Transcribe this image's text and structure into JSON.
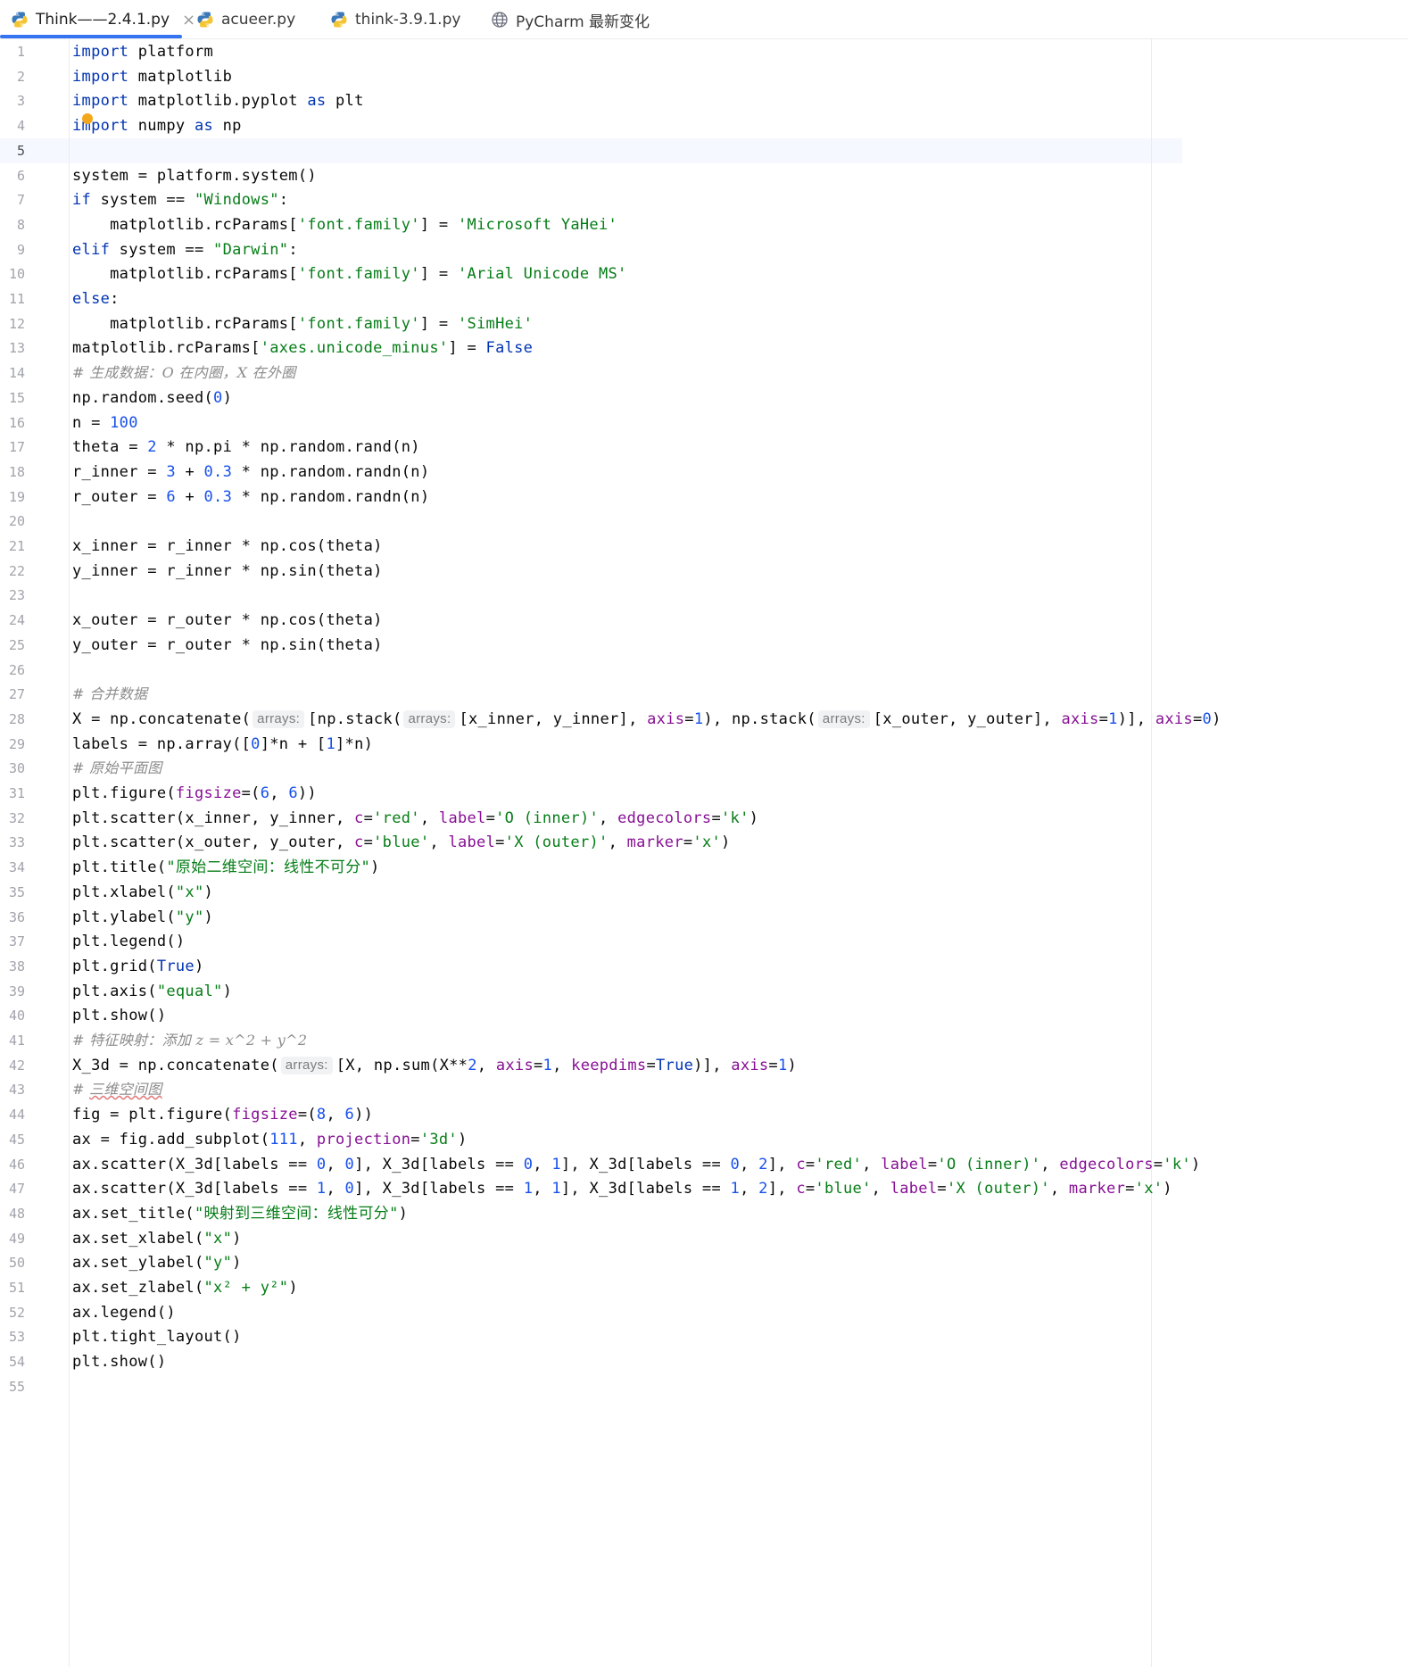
{
  "tabs": [
    {
      "label": "Think——2.4.1.py",
      "icon": "python-file-icon",
      "active": true,
      "closable": true
    },
    {
      "label": "acueer.py",
      "icon": "python-file-icon",
      "active": false
    },
    {
      "label": "think-3.9.1.py",
      "icon": "python-file-icon",
      "active": false
    },
    {
      "label": "PyCharm 最新变化",
      "icon": "globe-icon",
      "active": false
    }
  ],
  "editor": {
    "active_line": 5,
    "line_numbers": [
      "1",
      "2",
      "3",
      "4",
      "5",
      "6",
      "7",
      "8",
      "9",
      "10",
      "11",
      "12",
      "13",
      "14",
      "15",
      "16",
      "17",
      "18",
      "19",
      "20",
      "21",
      "22",
      "23",
      "24",
      "25",
      "26",
      "27",
      "28",
      "29",
      "30",
      "31",
      "32",
      "33",
      "34",
      "35",
      "36",
      "37",
      "38",
      "39",
      "40",
      "41",
      "42",
      "43",
      "44",
      "45",
      "46",
      "47",
      "48",
      "49",
      "50",
      "51",
      "52",
      "53",
      "54",
      "55"
    ],
    "lines": [
      [
        [
          "k",
          "import"
        ],
        [
          "t",
          " platform"
        ]
      ],
      [
        [
          "k",
          "import"
        ],
        [
          "t",
          " matplotlib"
        ]
      ],
      [
        [
          "k",
          "import"
        ],
        [
          "t",
          " matplotlib.pyplot "
        ],
        [
          "k",
          "as"
        ],
        [
          "t",
          " plt"
        ]
      ],
      [
        [
          "k",
          "import"
        ],
        [
          "t",
          " numpy "
        ],
        [
          "k",
          "as"
        ],
        [
          "t",
          " np"
        ]
      ],
      [],
      [
        [
          "t",
          "system = platform.system()"
        ]
      ],
      [
        [
          "k",
          "if"
        ],
        [
          "t",
          " system == "
        ],
        [
          "s",
          "\"Windows\""
        ],
        [
          "t",
          ":"
        ]
      ],
      [
        [
          "t",
          "    matplotlib.rcParams["
        ],
        [
          "s",
          "'font.family'"
        ],
        [
          "t",
          "] = "
        ],
        [
          "s",
          "'Microsoft YaHei'"
        ]
      ],
      [
        [
          "k",
          "elif"
        ],
        [
          "t",
          " system == "
        ],
        [
          "s",
          "\"Darwin\""
        ],
        [
          "t",
          ":"
        ]
      ],
      [
        [
          "t",
          "    matplotlib.rcParams["
        ],
        [
          "s",
          "'font.family'"
        ],
        [
          "t",
          "] = "
        ],
        [
          "s",
          "'Arial Unicode MS'"
        ]
      ],
      [
        [
          "k",
          "else"
        ],
        [
          "t",
          ":"
        ]
      ],
      [
        [
          "t",
          "    matplotlib.rcParams["
        ],
        [
          "s",
          "'font.family'"
        ],
        [
          "t",
          "] = "
        ],
        [
          "s",
          "'SimHei'"
        ]
      ],
      [
        [
          "t",
          "matplotlib.rcParams["
        ],
        [
          "s",
          "'axes.unicode_minus'"
        ],
        [
          "t",
          "] = "
        ],
        [
          "k",
          "False"
        ]
      ],
      [
        [
          "c",
          "# 生成数据：O 在内圈，X 在外圈"
        ]
      ],
      [
        [
          "t",
          "np.random.seed("
        ],
        [
          "n",
          "0"
        ],
        [
          "t",
          ")"
        ]
      ],
      [
        [
          "t",
          "n = "
        ],
        [
          "n",
          "100"
        ]
      ],
      [
        [
          "t",
          "theta = "
        ],
        [
          "n",
          "2"
        ],
        [
          "t",
          " * np.pi * np.random.rand(n)"
        ]
      ],
      [
        [
          "t",
          "r_inner = "
        ],
        [
          "n",
          "3"
        ],
        [
          "t",
          " + "
        ],
        [
          "n",
          "0.3"
        ],
        [
          "t",
          " * np.random.randn(n)"
        ]
      ],
      [
        [
          "t",
          "r_outer = "
        ],
        [
          "n",
          "6"
        ],
        [
          "t",
          " + "
        ],
        [
          "n",
          "0.3"
        ],
        [
          "t",
          " * np.random.randn(n)"
        ]
      ],
      [],
      [
        [
          "t",
          "x_inner = r_inner * np.cos(theta)"
        ]
      ],
      [
        [
          "t",
          "y_inner = r_inner * np.sin(theta)"
        ]
      ],
      [],
      [
        [
          "t",
          "x_outer = r_outer * np.cos(theta)"
        ]
      ],
      [
        [
          "t",
          "y_outer = r_outer * np.sin(theta)"
        ]
      ],
      [],
      [
        [
          "c",
          "# 合并数据"
        ]
      ],
      [
        [
          "t",
          "X = np.concatenate("
        ],
        [
          "h",
          "arrays:"
        ],
        [
          "t",
          "[np.stack("
        ],
        [
          "h",
          "arrays:"
        ],
        [
          "t",
          "[x_inner, y_inner], "
        ],
        [
          "kw",
          "axis"
        ],
        [
          "t",
          "="
        ],
        [
          "n",
          "1"
        ],
        [
          "t",
          "), np.stack("
        ],
        [
          "h",
          "arrays:"
        ],
        [
          "t",
          "[x_outer, y_outer], "
        ],
        [
          "kw",
          "axis"
        ],
        [
          "t",
          "="
        ],
        [
          "n",
          "1"
        ],
        [
          "t",
          ")], "
        ],
        [
          "kw",
          "axis"
        ],
        [
          "t",
          "="
        ],
        [
          "n",
          "0"
        ],
        [
          "t",
          ")"
        ]
      ],
      [
        [
          "t",
          "labels = np.array(["
        ],
        [
          "n",
          "0"
        ],
        [
          "t",
          "]*n + ["
        ],
        [
          "n",
          "1"
        ],
        [
          "t",
          "]*n)"
        ]
      ],
      [
        [
          "c",
          "# 原始平面图"
        ]
      ],
      [
        [
          "t",
          "plt.figure("
        ],
        [
          "kw",
          "figsize"
        ],
        [
          "t",
          "=("
        ],
        [
          "n",
          "6"
        ],
        [
          "t",
          ", "
        ],
        [
          "n",
          "6"
        ],
        [
          "t",
          "))"
        ]
      ],
      [
        [
          "t",
          "plt.scatter(x_inner, y_inner, "
        ],
        [
          "kw",
          "c"
        ],
        [
          "t",
          "="
        ],
        [
          "s",
          "'red'"
        ],
        [
          "t",
          ", "
        ],
        [
          "kw",
          "label"
        ],
        [
          "t",
          "="
        ],
        [
          "s",
          "'O (inner)'"
        ],
        [
          "t",
          ", "
        ],
        [
          "kw",
          "edgecolors"
        ],
        [
          "t",
          "="
        ],
        [
          "s",
          "'k'"
        ],
        [
          "t",
          ")"
        ]
      ],
      [
        [
          "t",
          "plt.scatter(x_outer, y_outer, "
        ],
        [
          "kw",
          "c"
        ],
        [
          "t",
          "="
        ],
        [
          "s",
          "'blue'"
        ],
        [
          "t",
          ", "
        ],
        [
          "kw",
          "label"
        ],
        [
          "t",
          "="
        ],
        [
          "s",
          "'X (outer)'"
        ],
        [
          "t",
          ", "
        ],
        [
          "kw",
          "marker"
        ],
        [
          "t",
          "="
        ],
        [
          "s",
          "'x'"
        ],
        [
          "t",
          ")"
        ]
      ],
      [
        [
          "t",
          "plt.title("
        ],
        [
          "s",
          "\"原始二维空间：线性不可分\""
        ],
        [
          "t",
          ")"
        ]
      ],
      [
        [
          "t",
          "plt.xlabel("
        ],
        [
          "s",
          "\"x\""
        ],
        [
          "t",
          ")"
        ]
      ],
      [
        [
          "t",
          "plt.ylabel("
        ],
        [
          "s",
          "\"y\""
        ],
        [
          "t",
          ")"
        ]
      ],
      [
        [
          "t",
          "plt.legend()"
        ]
      ],
      [
        [
          "t",
          "plt.grid("
        ],
        [
          "k",
          "True"
        ],
        [
          "t",
          ")"
        ]
      ],
      [
        [
          "t",
          "plt.axis("
        ],
        [
          "s",
          "\"equal\""
        ],
        [
          "t",
          ")"
        ]
      ],
      [
        [
          "t",
          "plt.show()"
        ]
      ],
      [
        [
          "c",
          "# 特征映射：添加 z = x^2 + y^2"
        ]
      ],
      [
        [
          "t",
          "X_3d = np.concatenate("
        ],
        [
          "h",
          "arrays:"
        ],
        [
          "t",
          "[X, np.sum(X**"
        ],
        [
          "n",
          "2"
        ],
        [
          "t",
          ", "
        ],
        [
          "kw",
          "axis"
        ],
        [
          "t",
          "="
        ],
        [
          "n",
          "1"
        ],
        [
          "t",
          ", "
        ],
        [
          "kw",
          "keepdims"
        ],
        [
          "t",
          "="
        ],
        [
          "k",
          "True"
        ],
        [
          "t",
          ")], "
        ],
        [
          "kw",
          "axis"
        ],
        [
          "t",
          "="
        ],
        [
          "n",
          "1"
        ],
        [
          "t",
          ")"
        ]
      ],
      [
        [
          "c",
          "# "
        ],
        [
          "cs",
          "三维空间图"
        ]
      ],
      [
        [
          "t",
          "fig = plt.figure("
        ],
        [
          "kw",
          "figsize"
        ],
        [
          "t",
          "=("
        ],
        [
          "n",
          "8"
        ],
        [
          "t",
          ", "
        ],
        [
          "n",
          "6"
        ],
        [
          "t",
          "))"
        ]
      ],
      [
        [
          "t",
          "ax = fig.add_subplot("
        ],
        [
          "n",
          "111"
        ],
        [
          "t",
          ", "
        ],
        [
          "kw",
          "projection"
        ],
        [
          "t",
          "="
        ],
        [
          "s",
          "'3d'"
        ],
        [
          "t",
          ")"
        ]
      ],
      [
        [
          "t",
          "ax.scatter(X_3d[labels == "
        ],
        [
          "n",
          "0"
        ],
        [
          "t",
          ", "
        ],
        [
          "n",
          "0"
        ],
        [
          "t",
          "], X_3d[labels == "
        ],
        [
          "n",
          "0"
        ],
        [
          "t",
          ", "
        ],
        [
          "n",
          "1"
        ],
        [
          "t",
          "], X_3d[labels == "
        ],
        [
          "n",
          "0"
        ],
        [
          "t",
          ", "
        ],
        [
          "n",
          "2"
        ],
        [
          "t",
          "], "
        ],
        [
          "kw",
          "c"
        ],
        [
          "t",
          "="
        ],
        [
          "s",
          "'red'"
        ],
        [
          "t",
          ", "
        ],
        [
          "kw",
          "label"
        ],
        [
          "t",
          "="
        ],
        [
          "s",
          "'O (inner)'"
        ],
        [
          "t",
          ", "
        ],
        [
          "kw",
          "edgecolors"
        ],
        [
          "t",
          "="
        ],
        [
          "s",
          "'k'"
        ],
        [
          "t",
          ")"
        ]
      ],
      [
        [
          "t",
          "ax.scatter(X_3d[labels == "
        ],
        [
          "n",
          "1"
        ],
        [
          "t",
          ", "
        ],
        [
          "n",
          "0"
        ],
        [
          "t",
          "], X_3d[labels == "
        ],
        [
          "n",
          "1"
        ],
        [
          "t",
          ", "
        ],
        [
          "n",
          "1"
        ],
        [
          "t",
          "], X_3d[labels == "
        ],
        [
          "n",
          "1"
        ],
        [
          "t",
          ", "
        ],
        [
          "n",
          "2"
        ],
        [
          "t",
          "], "
        ],
        [
          "kw",
          "c"
        ],
        [
          "t",
          "="
        ],
        [
          "s",
          "'blue'"
        ],
        [
          "t",
          ", "
        ],
        [
          "kw",
          "label"
        ],
        [
          "t",
          "="
        ],
        [
          "s",
          "'X (outer)'"
        ],
        [
          "t",
          ", "
        ],
        [
          "kw",
          "marker"
        ],
        [
          "t",
          "="
        ],
        [
          "s",
          "'x'"
        ],
        [
          "t",
          ")"
        ]
      ],
      [
        [
          "t",
          "ax.set_title("
        ],
        [
          "s",
          "\"映射到三维空间：线性可分\""
        ],
        [
          "t",
          ")"
        ]
      ],
      [
        [
          "t",
          "ax.set_xlabel("
        ],
        [
          "s",
          "\"x\""
        ],
        [
          "t",
          ")"
        ]
      ],
      [
        [
          "t",
          "ax.set_ylabel("
        ],
        [
          "s",
          "\"y\""
        ],
        [
          "t",
          ")"
        ]
      ],
      [
        [
          "t",
          "ax.set_zlabel("
        ],
        [
          "s",
          "\"x² + y²\""
        ],
        [
          "t",
          ")"
        ]
      ],
      [
        [
          "t",
          "ax.legend()"
        ]
      ],
      [
        [
          "t",
          "plt.tight_layout()"
        ]
      ],
      [
        [
          "t",
          "plt.show()"
        ]
      ],
      []
    ]
  },
  "colors": {
    "keyword": "#0033b3",
    "string": "#067d17",
    "number": "#1750eb",
    "comment": "#8c8c8c",
    "named_arg": "#871094",
    "tab_accent": "#3574f0"
  }
}
